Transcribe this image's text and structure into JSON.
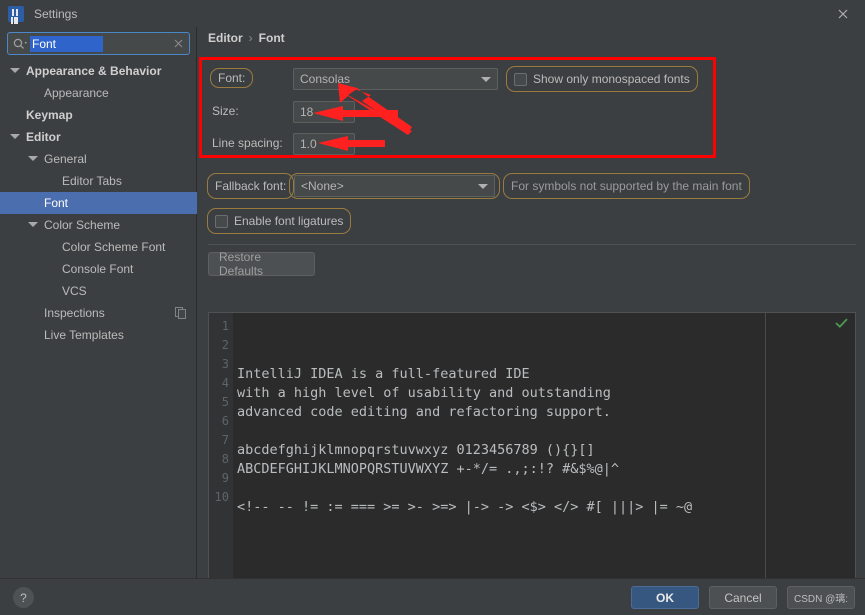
{
  "window": {
    "title": "Settings",
    "logo_icon": "intellij-idea-logo",
    "close_icon": "close-icon"
  },
  "sidebar": {
    "search": {
      "value": "Font",
      "icon": "search-icon",
      "clear_icon": "clear-icon"
    },
    "items": [
      {
        "label": "Appearance & Behavior",
        "indent": 0,
        "expander": true,
        "bold": true,
        "selected": false
      },
      {
        "label": "Appearance",
        "indent": 1,
        "expander": false,
        "bold": false,
        "selected": false
      },
      {
        "label": "Keymap",
        "indent": 0,
        "expander": false,
        "bold": true,
        "selected": false
      },
      {
        "label": "Editor",
        "indent": 0,
        "expander": true,
        "bold": true,
        "selected": false
      },
      {
        "label": "General",
        "indent": 1,
        "expander": true,
        "bold": false,
        "selected": false
      },
      {
        "label": "Editor Tabs",
        "indent": 2,
        "expander": false,
        "bold": false,
        "selected": false
      },
      {
        "label": "Font",
        "indent": 1,
        "expander": false,
        "bold": false,
        "selected": true
      },
      {
        "label": "Color Scheme",
        "indent": 1,
        "expander": true,
        "bold": false,
        "selected": false
      },
      {
        "label": "Color Scheme Font",
        "indent": 2,
        "expander": false,
        "bold": false,
        "selected": false
      },
      {
        "label": "Console Font",
        "indent": 2,
        "expander": false,
        "bold": false,
        "selected": false
      },
      {
        "label": "VCS",
        "indent": 2,
        "expander": false,
        "bold": false,
        "selected": false
      },
      {
        "label": "Inspections",
        "indent": 1,
        "expander": false,
        "bold": false,
        "selected": false,
        "trailing_icon": "copy-icon"
      },
      {
        "label": "Live Templates",
        "indent": 1,
        "expander": false,
        "bold": false,
        "selected": false
      }
    ]
  },
  "breadcrumb": {
    "parent": "Editor",
    "separator": "›",
    "current": "Font"
  },
  "font_settings": {
    "font_label": "Font:",
    "font_value": "Consolas",
    "show_monospaced_label": "Show only monospaced fonts",
    "show_monospaced_checked": false,
    "size_label": "Size:",
    "size_value": "18",
    "line_spacing_label": "Line spacing:",
    "line_spacing_value": "1.0",
    "fallback_label": "Fallback font:",
    "fallback_value": "<None>",
    "fallback_hint": "For symbols not supported by the main font",
    "ligatures_label": "Enable font ligatures",
    "ligatures_checked": false,
    "restore_defaults_label": "Restore Defaults",
    "highlight_color": "#9a7b3f"
  },
  "preview": {
    "status_icon": "green-checkmark-icon",
    "line_numbers": [
      "1",
      "2",
      "3",
      "4",
      "5",
      "6",
      "7",
      "8",
      "9",
      "10"
    ],
    "lines": [
      "IntelliJ IDEA is a full-featured IDE",
      "with a high level of usability and outstanding",
      "advanced code editing and refactoring support.",
      "",
      "abcdefghijklmnopqrstuvwxyz 0123456789 (){}[]",
      "ABCDEFGHIJKLMNOPQRSTUVWXYZ +-*/= .,;:!? #&$%@|^",
      "",
      "<!-- -- != := === >= >- >=> |-> -> <$> </> #[ |||> |= ~@",
      "",
      ""
    ]
  },
  "footer": {
    "help_label": "?",
    "ok_label": "OK",
    "cancel_label": "Cancel",
    "apply_label": "CSDN @璃:"
  },
  "annotation": {
    "box_color": "#ff0000",
    "arrow_color": "#ff2020",
    "arrow_count": 3
  }
}
